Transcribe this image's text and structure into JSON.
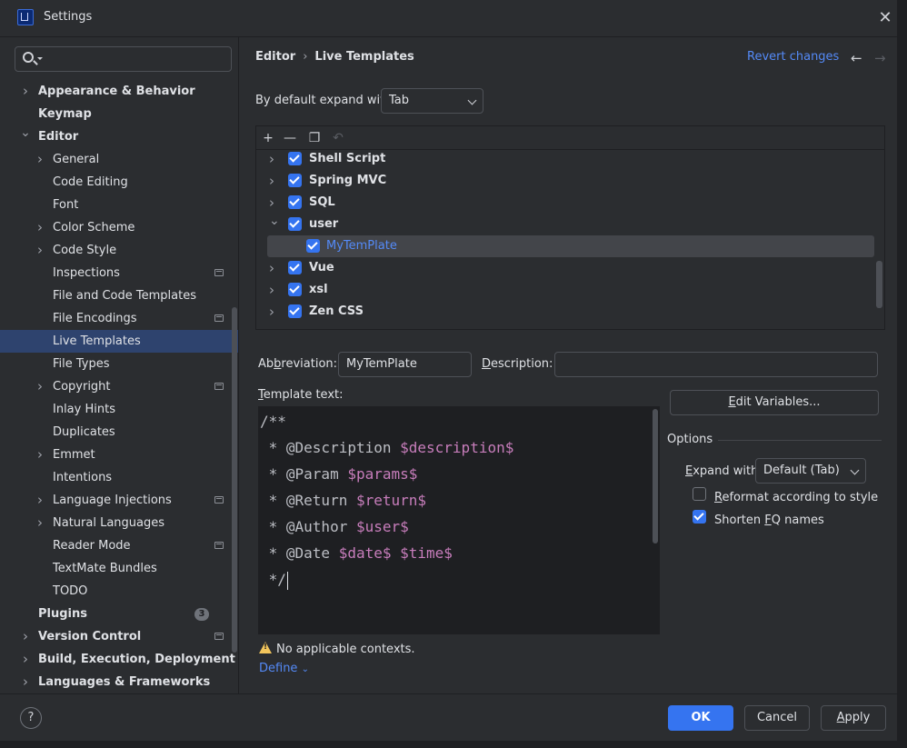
{
  "window": {
    "title": "Settings",
    "close_icon": "close-icon"
  },
  "search": {
    "placeholder": ""
  },
  "sidebar": {
    "items": [
      {
        "label": "Appearance & Behavior",
        "bold": true,
        "chevron": "right",
        "indent": 0
      },
      {
        "label": "Keymap",
        "bold": true,
        "chevron": "",
        "indent": 0
      },
      {
        "label": "Editor",
        "bold": true,
        "chevron": "down",
        "indent": 0
      },
      {
        "label": "General",
        "chevron": "right",
        "indent": 1
      },
      {
        "label": "Code Editing",
        "chevron": "",
        "indent": 1
      },
      {
        "label": "Font",
        "chevron": "",
        "indent": 1
      },
      {
        "label": "Color Scheme",
        "chevron": "right",
        "indent": 1
      },
      {
        "label": "Code Style",
        "chevron": "right",
        "indent": 1
      },
      {
        "label": "Inspections",
        "chevron": "",
        "indent": 1,
        "mark": true
      },
      {
        "label": "File and Code Templates",
        "chevron": "",
        "indent": 1
      },
      {
        "label": "File Encodings",
        "chevron": "",
        "indent": 1,
        "mark": true
      },
      {
        "label": "Live Templates",
        "chevron": "",
        "indent": 1,
        "selected": true
      },
      {
        "label": "File Types",
        "chevron": "",
        "indent": 1
      },
      {
        "label": "Copyright",
        "chevron": "right",
        "indent": 1,
        "mark": true
      },
      {
        "label": "Inlay Hints",
        "chevron": "",
        "indent": 1
      },
      {
        "label": "Duplicates",
        "chevron": "",
        "indent": 1
      },
      {
        "label": "Emmet",
        "chevron": "right",
        "indent": 1
      },
      {
        "label": "Intentions",
        "chevron": "",
        "indent": 1
      },
      {
        "label": "Language Injections",
        "chevron": "right",
        "indent": 1,
        "mark": true
      },
      {
        "label": "Natural Languages",
        "chevron": "right",
        "indent": 1
      },
      {
        "label": "Reader Mode",
        "chevron": "",
        "indent": 1,
        "mark": true
      },
      {
        "label": "TextMate Bundles",
        "chevron": "",
        "indent": 1
      },
      {
        "label": "TODO",
        "chevron": "",
        "indent": 1
      },
      {
        "label": "Plugins",
        "bold": true,
        "chevron": "",
        "indent": 0,
        "badge": "3"
      },
      {
        "label": "Version Control",
        "bold": true,
        "chevron": "right",
        "indent": 0,
        "mark": true
      },
      {
        "label": "Build, Execution, Deployment",
        "bold": true,
        "chevron": "right",
        "indent": 0
      },
      {
        "label": "Languages & Frameworks",
        "bold": true,
        "chevron": "right",
        "indent": 0
      }
    ]
  },
  "header": {
    "breadcrumb_parent": "Editor",
    "breadcrumb_current": "Live Templates",
    "revert_label": "Revert changes",
    "back_icon": "arrow-left-icon",
    "forward_icon": "arrow-right-icon"
  },
  "expand": {
    "label": "By default expand with",
    "value": "Tab"
  },
  "toolbar": {
    "add_icon": "plus-icon",
    "remove_icon": "minus-icon",
    "copy_icon": "copy-icon",
    "undo_icon": "undo-icon"
  },
  "template_groups": [
    {
      "name": "Shell Script",
      "checked": true,
      "chevron": "right",
      "child": false
    },
    {
      "name": "Spring MVC",
      "checked": true,
      "chevron": "right",
      "child": false
    },
    {
      "name": "SQL",
      "checked": true,
      "chevron": "right",
      "child": false
    },
    {
      "name": "user",
      "checked": true,
      "chevron": "down",
      "child": false
    },
    {
      "name": "MyTemPlate",
      "checked": true,
      "chevron": "",
      "child": true,
      "selected": true
    },
    {
      "name": "Vue",
      "checked": true,
      "chevron": "right",
      "child": false
    },
    {
      "name": "xsl",
      "checked": true,
      "chevron": "right",
      "child": false
    },
    {
      "name": "Zen CSS",
      "checked": true,
      "chevron": "right",
      "child": false
    }
  ],
  "abbreviation": {
    "label_pre": "Ab",
    "label_u": "b",
    "label_post": "reviation:",
    "value": "MyTemPlate"
  },
  "description": {
    "label_u": "D",
    "label_post": "escription:",
    "value": ""
  },
  "template_text": {
    "label_u": "T",
    "label_post": "emplate text:",
    "lines": [
      [
        {
          "t": "/**",
          "c": "plain"
        }
      ],
      [
        {
          "t": " * @Description ",
          "c": "plain"
        },
        {
          "t": "$description$",
          "c": "var"
        }
      ],
      [
        {
          "t": " * @Param ",
          "c": "plain"
        },
        {
          "t": "$params$",
          "c": "var"
        }
      ],
      [
        {
          "t": " * @Return ",
          "c": "plain"
        },
        {
          "t": "$return$",
          "c": "var"
        }
      ],
      [
        {
          "t": " * @Author ",
          "c": "plain"
        },
        {
          "t": "$user$",
          "c": "var"
        }
      ],
      [
        {
          "t": " * @Date ",
          "c": "plain"
        },
        {
          "t": "$date$",
          "c": "var"
        },
        {
          "t": " ",
          "c": "plain"
        },
        {
          "t": "$time$",
          "c": "var"
        }
      ],
      [
        {
          "t": " */",
          "c": "plain"
        }
      ]
    ]
  },
  "edit_variables": {
    "label_u": "E",
    "label_post": "dit Variables..."
  },
  "options": {
    "title": "Options",
    "expand_with_label_u": "E",
    "expand_with_label_post": "xpand with",
    "expand_with_value": "Default (Tab)",
    "reformat": {
      "label_u": "R",
      "label_post": "eformat according to style",
      "checked": false
    },
    "shorten": {
      "label_pre": "Shorten ",
      "label_u": "F",
      "label_post": "Q names",
      "checked": true
    }
  },
  "contexts": {
    "warning": "No applicable contexts.",
    "define": "Define",
    "warning_icon": "warning-icon",
    "define_chevron": "chevron-down-icon"
  },
  "footer": {
    "help": "?",
    "ok": "OK",
    "cancel": "Cancel",
    "apply_u": "A",
    "apply_post": "pply"
  },
  "colors": {
    "accent": "#3574f0",
    "link": "#548af7",
    "selection": "#2e436e",
    "variable": "#c77dbb",
    "background": "#2b2d30",
    "editor_bg": "#1e1f22"
  }
}
